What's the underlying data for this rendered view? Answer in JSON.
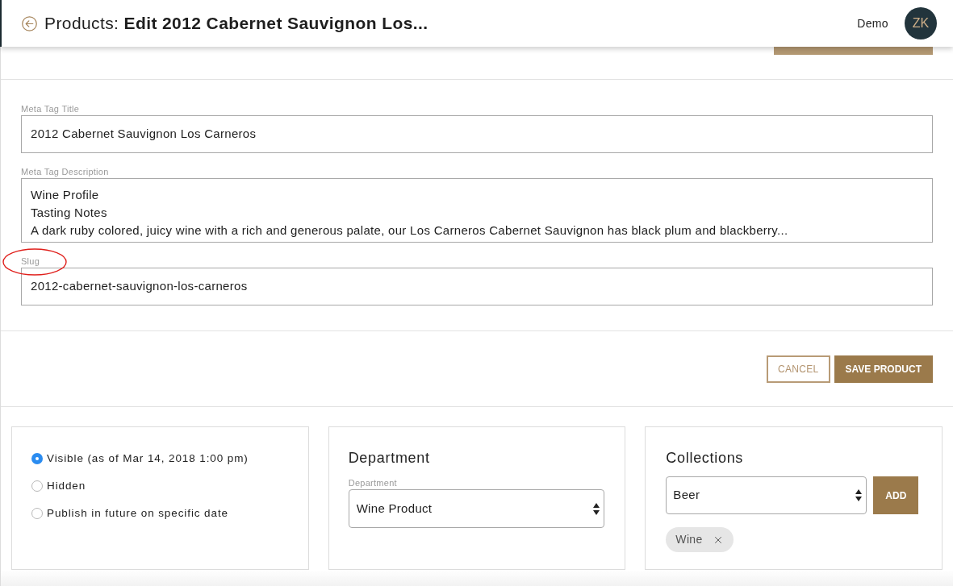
{
  "header": {
    "title": "Products: **Edit 2012 Cabernet Sauvignon Los...**",
    "user": "Demo",
    "avatar": "ZK"
  },
  "seo_fields": [
    {
      "label": "Meta Tag Title",
      "kind": "input",
      "value": "2012 Cabernet Sauvignon Los Carneros",
      "highlighted": false
    },
    {
      "label": "Meta Tag Description",
      "kind": "textarea",
      "value": "Wine Profile\nTasting Notes\nA dark ruby colored, juicy wine with a rich and generous palate, our Los Carneros Cabernet Sauvignon has black plum and blackberry...",
      "highlighted": false
    },
    {
      "label": "Slug",
      "kind": "input",
      "value": "2012-cabernet-sauvignon-los-carneros",
      "highlighted": true
    }
  ],
  "actions": [
    {
      "label": "CANCEL",
      "kind": "outline"
    },
    {
      "label": "SAVE PRODUCT",
      "kind": "primary"
    }
  ],
  "visibility": [
    {
      "label": "Visible (as of Mar 14, 2018 1:00 pm)",
      "selected": true
    },
    {
      "label": "Hidden",
      "selected": false
    },
    {
      "label": "Publish in future on specific date",
      "selected": false
    }
  ],
  "department": {
    "heading": "Department",
    "label": "Department",
    "value": "Wine Product"
  },
  "collections": {
    "heading": "Collections",
    "value": "Beer",
    "add_label": "ADD",
    "tags": [
      {
        "label": "Wine"
      }
    ]
  }
}
